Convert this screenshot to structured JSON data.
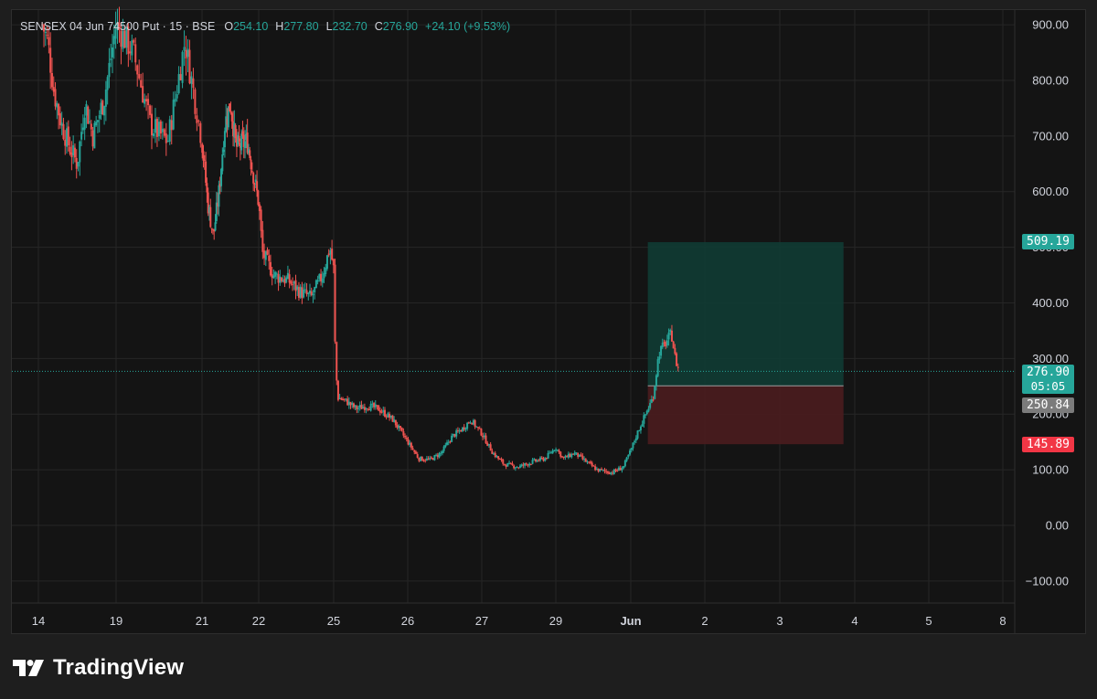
{
  "legend": {
    "symbol": "SENSEX 04 Jun 74500 Put · 15 · BSE",
    "open_label": "O",
    "open": "254.10",
    "high_label": "H",
    "high": "277.80",
    "low_label": "L",
    "low": "232.70",
    "close_label": "C",
    "close": "276.90",
    "change": "+24.10 (+9.53%)"
  },
  "price_tags": {
    "target": "509.19",
    "last_price": "276.90",
    "countdown": "05:05",
    "entry": "250.84",
    "stop": "145.89"
  },
  "brand": {
    "name": "TradingView",
    "logo_icon": "tradingview-logo-icon"
  },
  "colors": {
    "up": "#26a69a",
    "down": "#ef5350",
    "background": "#141414",
    "target_zone": "#0f3d35",
    "stop_zone": "#4a1c1e"
  },
  "chart_data": {
    "type": "candlestick",
    "title": "SENSEX 04 Jun 74500 Put",
    "interval": "15",
    "exchange": "BSE",
    "ylim": [
      -140,
      950
    ],
    "y_ticks": [
      "900.00",
      "800.00",
      "700.00",
      "600.00",
      "500.00",
      "400.00",
      "300.00",
      "200.00",
      "100.00",
      "0.00",
      "−100.00"
    ],
    "y_tick_values": [
      900,
      800,
      700,
      600,
      500,
      400,
      300,
      200,
      100,
      0,
      -100
    ],
    "x_ticks": [
      "14",
      "19",
      "21",
      "22",
      "25",
      "26",
      "27",
      "29",
      "Jun",
      "2",
      "3",
      "4",
      "5",
      "8"
    ],
    "x_tick_session_index": [
      0,
      1,
      2,
      3,
      4,
      5,
      6,
      7,
      8,
      9,
      10,
      11,
      12,
      13
    ],
    "last_price": 276.9,
    "position": {
      "type": "long",
      "entry": 250.84,
      "target": 509.19,
      "stop": 145.89
    },
    "close_path": [
      [
        0.05,
        900
      ],
      [
        0.12,
        870
      ],
      [
        0.2,
        780
      ],
      [
        0.3,
        720
      ],
      [
        0.4,
        680
      ],
      [
        0.5,
        650
      ],
      [
        0.6,
        760
      ],
      [
        0.7,
        700
      ],
      [
        0.85,
        770
      ],
      [
        1.0,
        900
      ],
      [
        1.2,
        850
      ],
      [
        1.4,
        720
      ],
      [
        1.6,
        690
      ],
      [
        1.8,
        870
      ],
      [
        2.0,
        690
      ],
      [
        2.1,
        580
      ],
      [
        2.2,
        520
      ],
      [
        2.3,
        600
      ],
      [
        2.4,
        720
      ],
      [
        2.5,
        760
      ],
      [
        2.6,
        680
      ],
      [
        2.8,
        690
      ],
      [
        3.0,
        580
      ],
      [
        3.05,
        490
      ],
      [
        3.2,
        450
      ],
      [
        3.4,
        440
      ],
      [
        3.55,
        420
      ],
      [
        3.7,
        410
      ],
      [
        3.85,
        450
      ],
      [
        3.95,
        500
      ],
      [
        4.0,
        460
      ],
      [
        4.02,
        320
      ],
      [
        4.05,
        230
      ],
      [
        4.15,
        225
      ],
      [
        4.3,
        210
      ],
      [
        4.45,
        215
      ],
      [
        4.6,
        210
      ],
      [
        4.8,
        190
      ],
      [
        5.0,
        150
      ],
      [
        5.15,
        120
      ],
      [
        5.3,
        118
      ],
      [
        5.45,
        130
      ],
      [
        5.6,
        160
      ],
      [
        5.75,
        175
      ],
      [
        5.85,
        190
      ],
      [
        6.0,
        165
      ],
      [
        6.15,
        130
      ],
      [
        6.3,
        110
      ],
      [
        6.5,
        105
      ],
      [
        6.7,
        115
      ],
      [
        6.85,
        120
      ],
      [
        7.0,
        140
      ],
      [
        7.1,
        120
      ],
      [
        7.25,
        130
      ],
      [
        7.4,
        115
      ],
      [
        7.55,
        100
      ],
      [
        7.75,
        95
      ],
      [
        7.9,
        105
      ],
      [
        8.0,
        135
      ],
      [
        8.1,
        170
      ],
      [
        8.2,
        200
      ],
      [
        8.3,
        230
      ],
      [
        8.38,
        310
      ],
      [
        8.48,
        330
      ],
      [
        8.55,
        345
      ],
      [
        8.6,
        300
      ],
      [
        8.65,
        277
      ]
    ]
  }
}
